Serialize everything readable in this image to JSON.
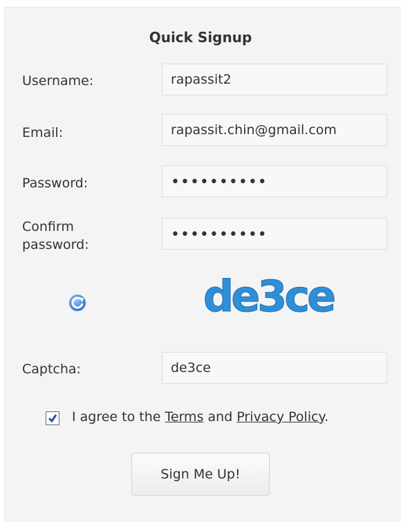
{
  "form": {
    "title": "Quick Signup",
    "username_label": "Username:",
    "username_value": "rapassit2",
    "email_label": "Email:",
    "email_value": "rapassit.chin@gmail.com",
    "password_label": "Password:",
    "password_value": "••••••••••",
    "confirm_label_line1": "Confirm",
    "confirm_label_line2": "password:",
    "confirm_value": "••••••••••",
    "captcha_image_text": "de3ce",
    "captcha_label": "Captcha:",
    "captcha_value": "de3ce",
    "agree_prefix": "I agree to the",
    "terms_link": "Terms",
    "agree_middle": "and",
    "privacy_link": "Privacy Policy",
    "agree_suffix": ".",
    "submit_label": "Sign Me Up!"
  },
  "icons": {
    "refresh": "refresh-icon",
    "checkbox": "checkmark-icon"
  },
  "colors": {
    "captcha": "#2f8fd6",
    "refresh": "#3a7fd0",
    "checkbox_check": "#2b4fa3"
  },
  "state": {
    "agree_checked": true
  }
}
